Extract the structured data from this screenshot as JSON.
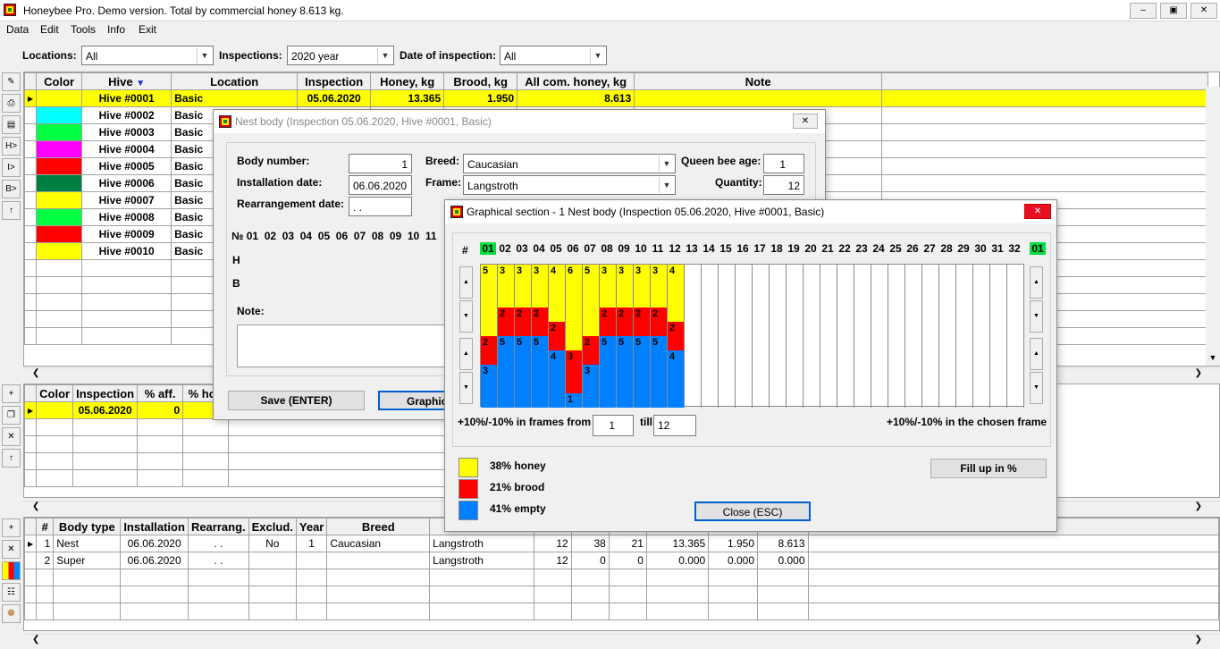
{
  "window": {
    "title": "Honeybee Pro. Demo version. Total by commercial honey 8.613 kg.",
    "minimize": "–",
    "restore": "▣",
    "close": "✕"
  },
  "menu": [
    "Data",
    "Edit",
    "Tools",
    "Info",
    "Exit"
  ],
  "filters": {
    "locations_label": "Locations:",
    "locations_value": "All",
    "inspections_label": "Inspections:",
    "inspections_value": "2020 year",
    "date_label": "Date of inspection:",
    "date_value": "All"
  },
  "toolbar_top": [
    "page-icon",
    "printer-icon",
    "document-icon",
    "H>",
    "I>",
    "B>",
    "↑"
  ],
  "toolbar_mid": [
    "+",
    "copy-icon",
    "✕",
    "↑"
  ],
  "toolbar_bot": [
    "+",
    "✕",
    "color-icon",
    "tree-icon",
    "bee-icon"
  ],
  "hives": {
    "columns": [
      "Color",
      "Hive",
      "Location",
      "Inspection",
      "Honey, kg",
      "Brood, kg",
      "All com. honey, kg",
      "Note"
    ],
    "sort_icon": "▼",
    "rows": [
      {
        "color": "#ffff00",
        "hive": "Hive #0001",
        "location": "Basic",
        "inspection": "05.06.2020",
        "honey": "13.365",
        "brood": "1.950",
        "allhoney": "8.613",
        "selected": true
      },
      {
        "color": "#00ffff",
        "hive": "Hive #0002",
        "location": "Basic"
      },
      {
        "color": "#00ff40",
        "hive": "Hive #0003",
        "location": "Basic"
      },
      {
        "color": "#ff00ff",
        "hive": "Hive #0004",
        "location": "Basic"
      },
      {
        "color": "#ff0000",
        "hive": "Hive #0005",
        "location": "Basic"
      },
      {
        "color": "#008040",
        "hive": "Hive #0006",
        "location": "Basic"
      },
      {
        "color": "#ffff00",
        "hive": "Hive #0007",
        "location": "Basic"
      },
      {
        "color": "#00ff40",
        "hive": "Hive #0008",
        "location": "Basic"
      },
      {
        "color": "#ff0000",
        "hive": "Hive #0009",
        "location": "Basic"
      },
      {
        "color": "#ffff00",
        "hive": "Hive #0010",
        "location": "Basic"
      }
    ]
  },
  "inspections": {
    "columns": [
      "Color",
      "Inspection",
      "% aff.",
      "% hon"
    ],
    "row": {
      "inspection": "05.06.2020",
      "aff": "0",
      "hon": "3"
    }
  },
  "bodies": {
    "columns": [
      "#",
      "Body type",
      "Installation",
      "Rearrang.",
      "Exclud.",
      "Year",
      "Breed"
    ],
    "rows": [
      {
        "n": "1",
        "type": "Nest",
        "install": "06.06.2020",
        "rearr": ". .",
        "exclud": "No",
        "year": "1",
        "breed": "Caucasian",
        "frame": "Langstroth",
        "qty": "12",
        "h": "38",
        "b": "21",
        "honey": "13.365",
        "brood": "1.950",
        "com": "8.613"
      },
      {
        "n": "2",
        "type": "Super",
        "install": "06.06.2020",
        "rearr": ". .",
        "exclud": "",
        "year": "",
        "breed": "",
        "frame": "Langstroth",
        "qty": "12",
        "h": "0",
        "b": "0",
        "honey": "0.000",
        "brood": "0.000",
        "com": "0.000"
      }
    ]
  },
  "nest_dialog": {
    "title": "Nest body (Inspection 05.06.2020, Hive #0001, Basic)",
    "body_number_label": "Body number:",
    "body_number": "1",
    "install_label": "Installation date:",
    "install": "06.06.2020",
    "rearr_label": "Rearrangement date:",
    "rearr": ". .",
    "breed_label": "Breed:",
    "breed": "Caucasian",
    "frame_label": "Frame:",
    "frame": "Langstroth",
    "queen_label": "Queen bee age:",
    "queen": "1",
    "qty_label": "Quantity:",
    "qty": "12",
    "numbers_label": "№ 01  02  03  04  05  06  07  08  09  10  11",
    "h_label": "H",
    "b_label": "B",
    "h_vals": [
      "5",
      "3",
      "3",
      "3",
      "4",
      "6",
      "5",
      "3",
      "3",
      "3",
      "3"
    ],
    "b_vals": [
      "2",
      "2",
      "2",
      "2",
      "3",
      "2",
      "2",
      "2",
      "2",
      "2",
      "2"
    ],
    "note_label": "Note:",
    "save": "Save (ENTER)",
    "graphic": "Graphic"
  },
  "graph_dialog": {
    "title": "Graphical section - 1 Nest body (Inspection 05.06.2020, Hive #0001, Basic)",
    "hash": "#",
    "frame_numbers": [
      "01",
      "02",
      "03",
      "04",
      "05",
      "06",
      "07",
      "08",
      "09",
      "10",
      "11",
      "12",
      "13",
      "14",
      "15",
      "16",
      "17",
      "18",
      "19",
      "20",
      "21",
      "22",
      "23",
      "24",
      "25",
      "26",
      "27",
      "28",
      "29",
      "30",
      "31",
      "32",
      "01"
    ],
    "frames": [
      {
        "h": 5,
        "b": 2,
        "e": 3
      },
      {
        "h": 3,
        "b": 2,
        "e": 5
      },
      {
        "h": 3,
        "b": 2,
        "e": 5
      },
      {
        "h": 3,
        "b": 2,
        "e": 5
      },
      {
        "h": 4,
        "b": 2,
        "e": 4
      },
      {
        "h": 6,
        "b": 3,
        "e": 1
      },
      {
        "h": 5,
        "b": 2,
        "e": 3
      },
      {
        "h": 3,
        "b": 2,
        "e": 5
      },
      {
        "h": 3,
        "b": 2,
        "e": 5
      },
      {
        "h": 3,
        "b": 2,
        "e": 5
      },
      {
        "h": 3,
        "b": 2,
        "e": 5
      },
      {
        "h": 4,
        "b": 2,
        "e": 4
      }
    ],
    "range_label": "+10%/-10% in frames from",
    "from": "1",
    "till_label": "till",
    "till": "12",
    "chosen_label": "+10%/-10% in the chosen frame",
    "legend": [
      {
        "label": "38% honey",
        "color": "#ffff00"
      },
      {
        "label": "21% brood",
        "color": "#ff0000"
      },
      {
        "label": "41% empty",
        "color": "#0080ff"
      }
    ],
    "fill_btn": "Fill up in %",
    "close_btn": "Close (ESC)"
  },
  "colors": {
    "honey": "#ffff00",
    "brood": "#ff0000",
    "empty": "#0080ff",
    "highlight": "#00e040"
  }
}
